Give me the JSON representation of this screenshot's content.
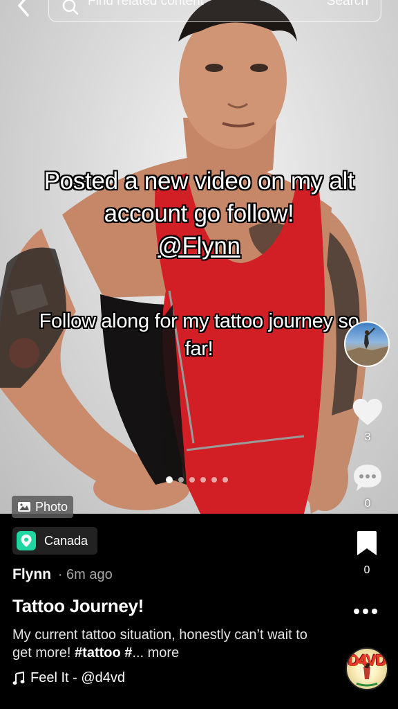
{
  "search": {
    "placeholder": "Find related content",
    "button_label": "Search"
  },
  "captions": {
    "line1": "Posted a new video on my alt account go follow!",
    "mention": "@Flynn",
    "line2": "Follow along for my tattoo journey so far!"
  },
  "actions": {
    "likes": "3",
    "comments": "0",
    "bookmarks": "0"
  },
  "carousel": {
    "total": 6,
    "current": 1
  },
  "badge": {
    "label": "Photo"
  },
  "post": {
    "location": "Canada",
    "author": "Flynn",
    "time_ago": "· 6m ago",
    "title": "Tattoo Journey!",
    "description": "My current tattoo situation, honestly can’t wait to get more! ",
    "hashtags": "#tattoo #",
    "more": "... more",
    "music": "Feel It - @d4vd"
  },
  "music_disc_text": "D4VD",
  "colors": {
    "location_pin": "#20d5a0",
    "tank_top": "#d21f26",
    "background": "#000000"
  },
  "icons": [
    "back-chevron-icon",
    "search-icon",
    "heart-icon",
    "comment-icon",
    "bookmark-icon",
    "more-dots-icon",
    "photo-icon",
    "location-pin-icon",
    "music-note-icon"
  ]
}
